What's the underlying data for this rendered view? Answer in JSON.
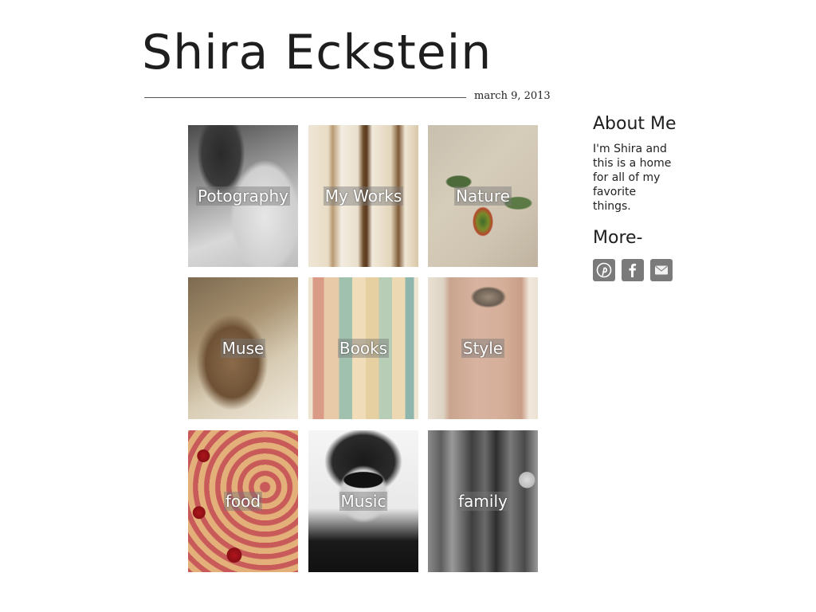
{
  "header": {
    "title": "Shira Eckstein",
    "date": "march 9, 2013"
  },
  "grid": {
    "tiles": [
      {
        "label": "Potography"
      },
      {
        "label": "My Works"
      },
      {
        "label": "Nature"
      },
      {
        "label": "Muse"
      },
      {
        "label": "Books"
      },
      {
        "label": "Style"
      },
      {
        "label": "food"
      },
      {
        "label": "Music"
      },
      {
        "label": "family"
      }
    ]
  },
  "sidebar": {
    "about_heading": "About Me",
    "about_text": "I'm Shira and this is a home for all of my favorite things.",
    "more_heading": "More-",
    "social_icons": [
      "pinterest-icon",
      "facebook-icon",
      "mail-icon"
    ]
  },
  "colors": {
    "social_button": "#7a7a7a",
    "text": "#222222"
  }
}
